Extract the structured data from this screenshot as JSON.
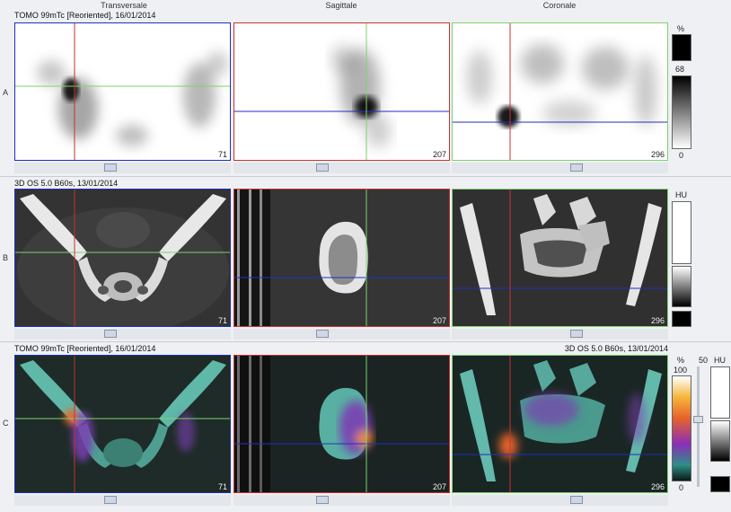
{
  "columns": [
    "Transversale",
    "Sagittale",
    "Coronale"
  ],
  "rows": [
    "A",
    "B",
    "C"
  ],
  "series": {
    "tomo": "TOMO 99mTc [Reoriented], 16/01/2014",
    "ct": "3D  OS  5.0  B60s, 13/01/2014"
  },
  "slices": {
    "transversal": "71",
    "sagittal": "207",
    "coronal": "296"
  },
  "scales": {
    "a_unit": "%",
    "a_max": "68",
    "a_min": "0",
    "b_unit": "HU",
    "c_unit": "%",
    "c_max": "100",
    "c_min": "0",
    "c_extra_unit": "HU",
    "c_value": "50"
  },
  "colors": {
    "frame_blue": "#1f2fbf",
    "frame_red": "#c8322f",
    "frame_green": "#7ed36b"
  }
}
